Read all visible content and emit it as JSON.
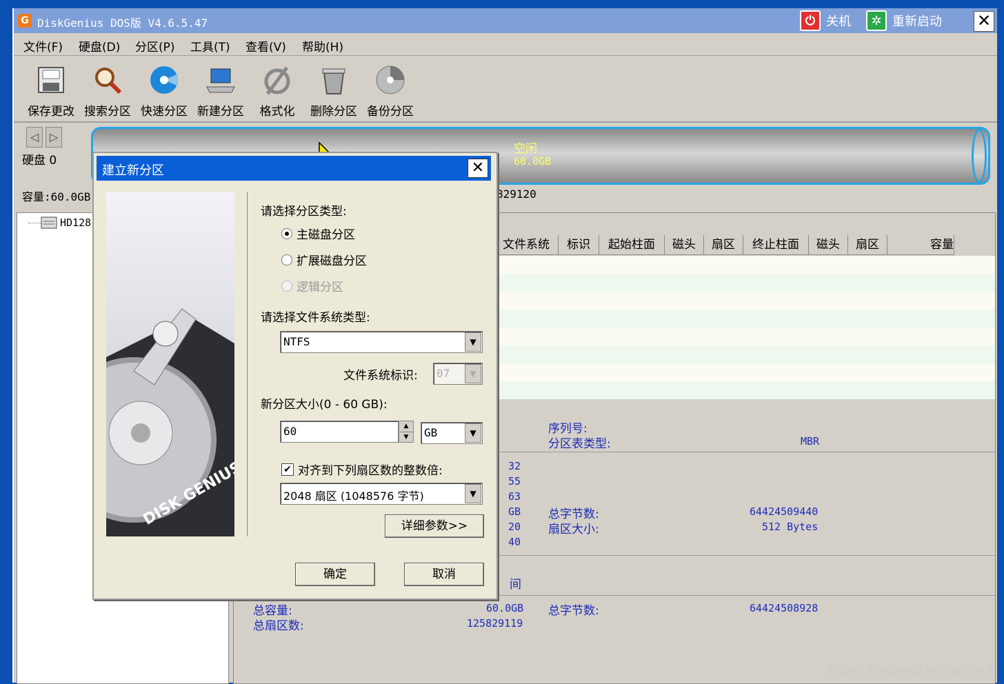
{
  "app": {
    "title": "DiskGenius DOS版 V4.6.5.47",
    "logo": "G",
    "shutdown": "关机",
    "restart": "重新启动"
  },
  "menu": [
    "文件(F)",
    "硬盘(D)",
    "分区(P)",
    "工具(T)",
    "查看(V)",
    "帮助(H)"
  ],
  "toolbar": [
    "保存更改",
    "搜索分区",
    "快速分区",
    "新建分区",
    "格式化",
    "删除分区",
    "备份分区"
  ],
  "disk": {
    "label": "硬盘 0",
    "capacity": "容量:60.0GB",
    "sectors_partial": "829120",
    "free_label": "空闲",
    "free_size": "60.0GB",
    "tree_item": "HD128:"
  },
  "columns": [
    "文件系统",
    "标识",
    "起始柱面",
    "磁头",
    "扇区",
    "终止柱面",
    "磁头",
    "扇区",
    "容量"
  ],
  "info": {
    "serial_label": "序列号:",
    "ptable_label": "分区表类型:",
    "ptable_value": "MBR",
    "partial_values": [
      "32",
      "55",
      "63",
      "GB",
      "20",
      "40"
    ],
    "total_bytes_label": "总字节数:",
    "total_bytes_value": "64424509440",
    "sector_size_label": "扇区大小:",
    "sector_size_value": "512 Bytes",
    "space_partial": "间",
    "total_cap_label": "总容量:",
    "total_cap_value": "60.0GB",
    "total_sectors_label": "总扇区数:",
    "total_sectors_value": "125829119",
    "total_bytes2_label": "总字节数:",
    "total_bytes2_value": "64424508928"
  },
  "dialog": {
    "title": "建立新分区",
    "ptype_label": "请选择分区类型:",
    "opt_primary": "主磁盘分区",
    "opt_extended": "扩展磁盘分区",
    "opt_logical": "逻辑分区",
    "fs_label": "请选择文件系统类型:",
    "fs_value": "NTFS",
    "fsid_label": "文件系统标识:",
    "fsid_value": "07",
    "size_label": "新分区大小(0 - 60 GB):",
    "size_value": "60",
    "unit_value": "GB",
    "align_label": "对齐到下列扇区数的整数倍:",
    "align_value": "2048 扇区 (1048576 字节)",
    "detail_btn": "详细参数>>",
    "ok_btn": "确定",
    "cancel_btn": "取消",
    "art_text": "DISK GENIUS"
  },
  "watermark": "https://blog.csdn.net/mrcrack"
}
